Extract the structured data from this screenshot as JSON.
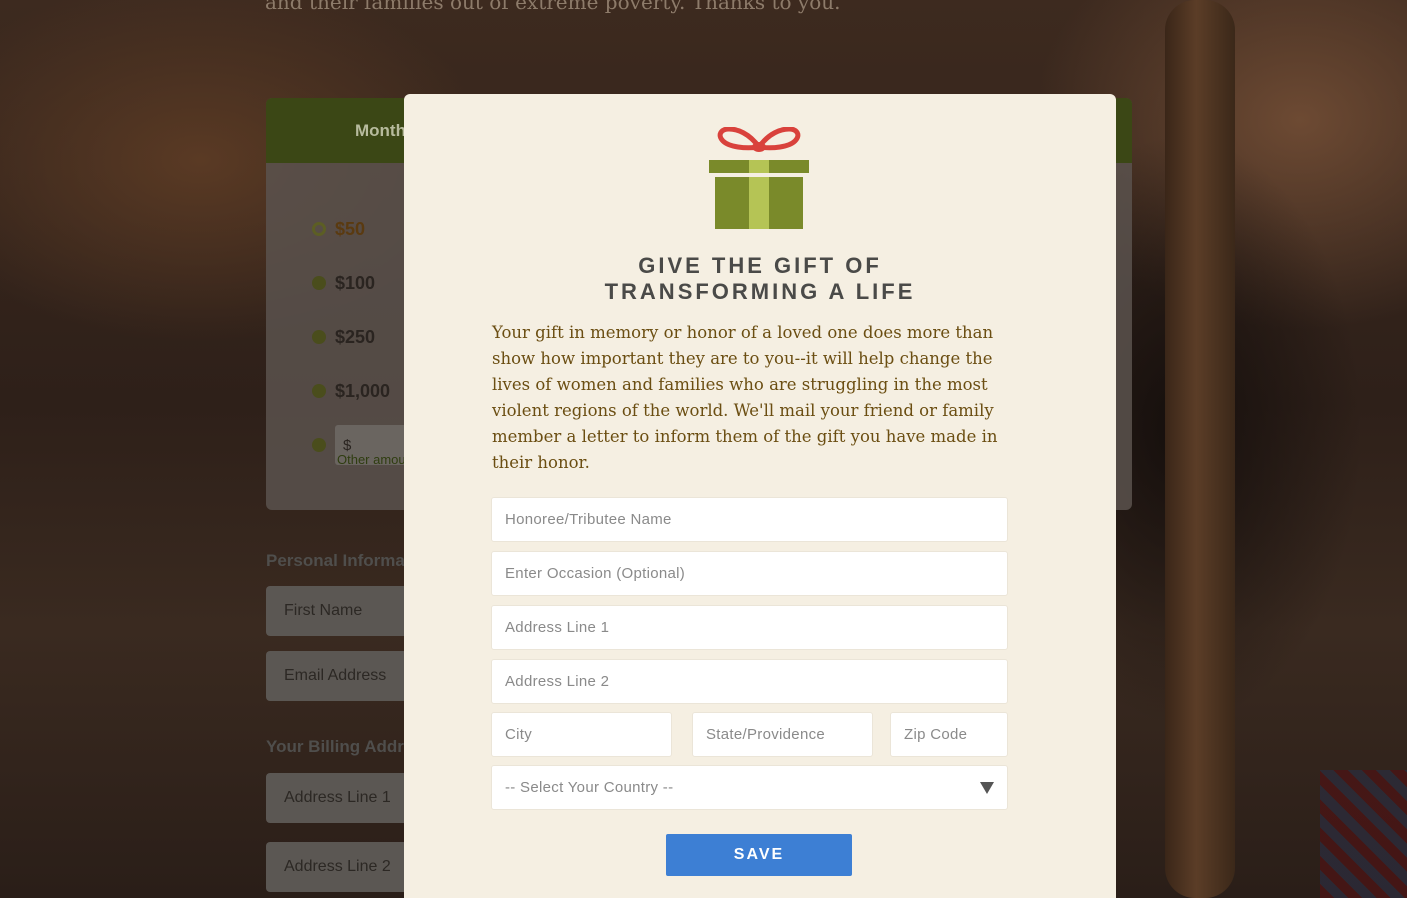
{
  "background": {
    "intro_text": "and their families out of extreme poverty. Thanks to you.",
    "tab_monthly": "Monthly",
    "amounts": [
      "$50",
      "$100",
      "$250",
      "$1,000"
    ],
    "selected_amount": "$50",
    "other_prefix": "$",
    "other_note": "Other amount",
    "personal_heading": "Personal Information",
    "first_name_placeholder": "First Name",
    "email_placeholder": "Email Address",
    "billing_heading": "Your Billing Address",
    "address1_placeholder": "Address Line 1",
    "address2_placeholder": "Address Line 2"
  },
  "modal": {
    "icon": "gift-icon",
    "title_line1": "GIVE THE GIFT OF",
    "title_line2": "TRANSFORMING A LIFE",
    "body": "Your gift in memory or honor of a loved one does more than show how important they are to you--it will help change the lives of women and families who are struggling in the most violent regions of the world. We'll mail your friend or family member a letter to inform them of the gift you have made in their honor.",
    "fields": {
      "honoree": "Honoree/Tributee Name",
      "occasion": "Enter Occasion (Optional)",
      "address1": "Address Line 1",
      "address2": "Address Line 2",
      "city": "City",
      "state": "State/Providence",
      "zip": "Zip Code"
    },
    "country_select": "-- Select Your Country --",
    "save_label": "SAVE"
  },
  "colors": {
    "modal_bg": "#f5efe2",
    "body_text": "#6b4e12",
    "save_button": "#3d7fd4",
    "gift_ribbon": "#d9423c",
    "gift_box_dark": "#7a8a2a",
    "gift_box_light": "#b5c455"
  }
}
